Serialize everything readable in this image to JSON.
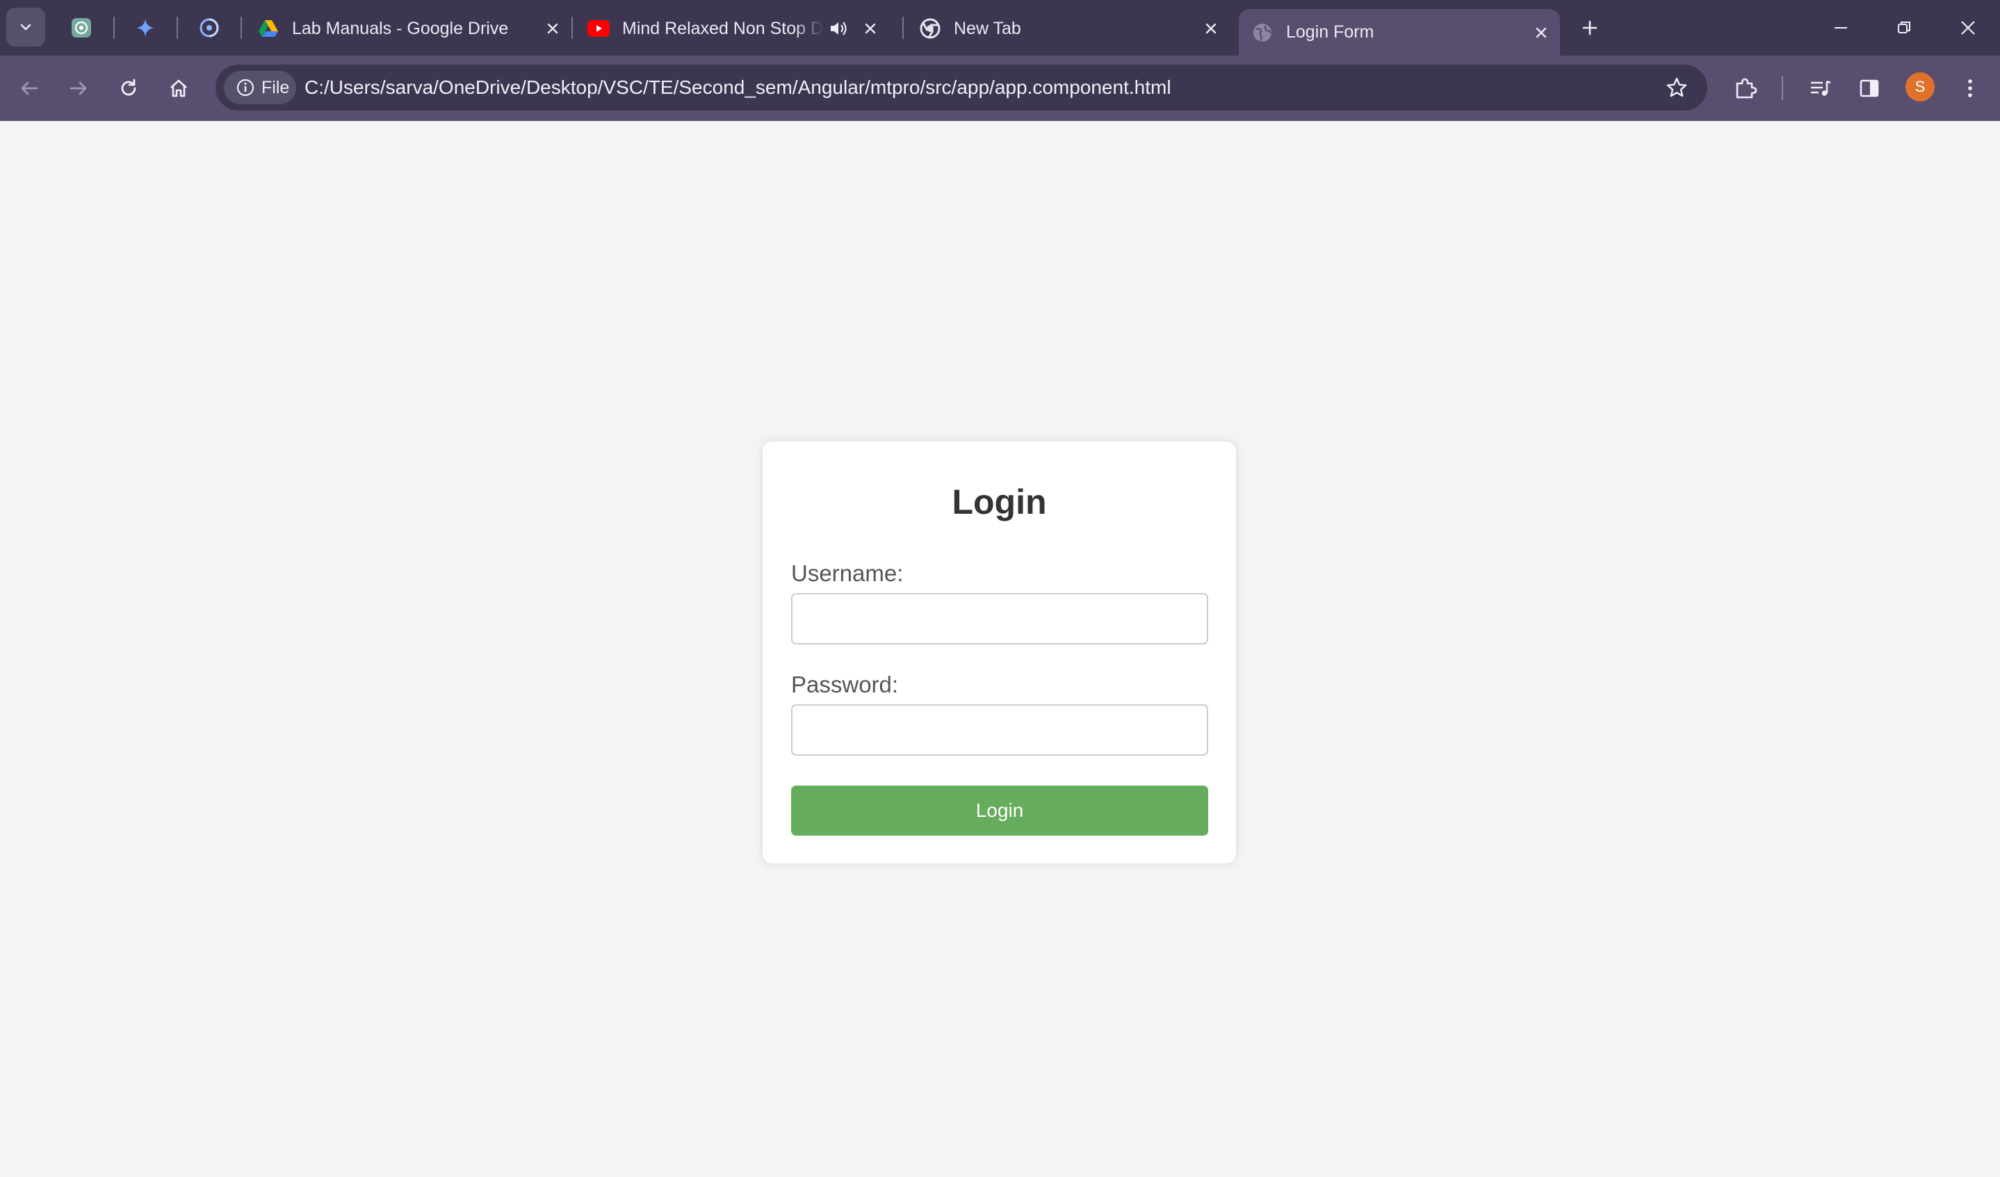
{
  "browser": {
    "tabs": [
      {
        "title": "Lab Manuals - Google Drive",
        "icon": "google-drive-icon",
        "active": false
      },
      {
        "title": "Mind Relaxed Non Stop Dance",
        "icon": "youtube-icon",
        "active": false,
        "audio": true
      },
      {
        "title": "New Tab",
        "icon": "chrome-icon",
        "active": false
      },
      {
        "title": "Login Form",
        "icon": "globe-icon",
        "active": true
      }
    ],
    "pinned_tabs": [
      "chatgpt-icon",
      "gemini-icon",
      "app-icon"
    ],
    "omnibox": {
      "scheme_chip": "File",
      "url": "C:/Users/sarva/OneDrive/Desktop/VSC/TE/Second_sem/Angular/mtpro/src/app/app.component.html"
    },
    "profile_initial": "S",
    "colors": {
      "tabstrip": "#3d3650",
      "toolbar": "#584f70",
      "avatar": "#e0712a"
    }
  },
  "login": {
    "heading": "Login",
    "username_label": "Username:",
    "username_value": "",
    "password_label": "Password:",
    "password_value": "",
    "submit_label": "Login",
    "colors": {
      "button": "#66ac5d",
      "background": "#f4f4f4"
    }
  }
}
